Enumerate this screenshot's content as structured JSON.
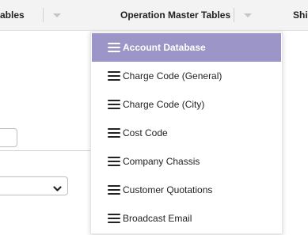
{
  "topbar": {
    "tabs": [
      {
        "label": "ables"
      },
      {
        "label": "Operation Master Tables"
      },
      {
        "label": "Shi"
      }
    ]
  },
  "dropdown": {
    "items": [
      {
        "label": "Account Database",
        "active": true
      },
      {
        "label": "Charge Code (General)"
      },
      {
        "label": "Charge Code (City)"
      },
      {
        "label": "Cost Code"
      },
      {
        "label": "Company Chassis"
      },
      {
        "label": "Customer Quotations"
      },
      {
        "label": "Broadcast Email"
      }
    ]
  },
  "colors": {
    "active_item_bg": "#9b95c8",
    "topbar_bg": "#f3f3f3"
  },
  "icons": {
    "menu_item_icon": "hamburger-icon",
    "tab_caret": "caret-down-icon",
    "select_chevron": "chevron-down-icon"
  }
}
